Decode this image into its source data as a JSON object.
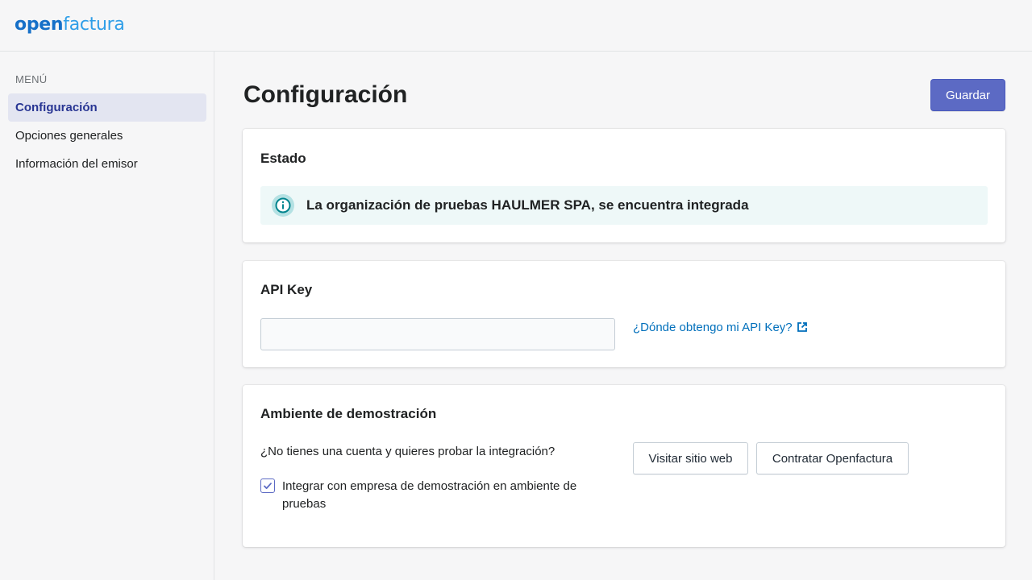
{
  "brand": {
    "logo_part1": "open",
    "logo_part2": "factura"
  },
  "sidebar": {
    "heading": "MENÚ",
    "items": [
      {
        "label": "Configuración",
        "active": true
      },
      {
        "label": "Opciones generales",
        "active": false
      },
      {
        "label": "Información del emisor",
        "active": false
      }
    ]
  },
  "page": {
    "title": "Configuración",
    "save_label": "Guardar"
  },
  "estado": {
    "title": "Estado",
    "message": "La organización de pruebas HAULMER SPA, se encuentra integrada",
    "icon": "info-icon"
  },
  "api_key": {
    "title": "API Key",
    "value": "",
    "placeholder": "",
    "help_link": "¿Dónde obtengo mi API Key?",
    "help_icon": "external-link-icon"
  },
  "demo": {
    "title": "Ambiente de demostración",
    "question": "¿No tienes una cuenta y quieres probar la integración?",
    "checkbox_label": "Integrar con empresa de demostración en ambiente de pruebas",
    "checkbox_checked": true,
    "visit_label": "Visitar sitio web",
    "hire_label": "Contratar Openfactura"
  },
  "colors": {
    "primary": "#5c6ac4",
    "link": "#006fbb",
    "banner_bg": "#eef8f8",
    "sidebar_active_bg": "#e3e5f1"
  }
}
